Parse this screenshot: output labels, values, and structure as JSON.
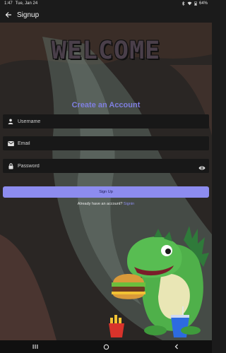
{
  "status_bar": {
    "time": "1:47",
    "date": "Tue, Jan 24",
    "battery": "64%",
    "icons": [
      "bluetooth-icon",
      "wifi-icon",
      "battery-icon"
    ]
  },
  "app_bar": {
    "title": "Signup",
    "back_icon": "arrow-back-icon"
  },
  "welcome_banner": "WELCOME",
  "heading": "Create an Account",
  "form": {
    "username": {
      "value": "",
      "placeholder": "Username",
      "icon": "person-icon"
    },
    "email": {
      "value": "",
      "placeholder": "Email",
      "icon": "mail-icon"
    },
    "password": {
      "value": "",
      "placeholder": "Password",
      "icon": "lock-icon",
      "toggle_icon": "eye-icon"
    },
    "submit_label": "Sign Up"
  },
  "login_prompt": {
    "text": "Already have an account?",
    "link": "Signin"
  },
  "colors": {
    "accent": "#8d8cef",
    "background": "#1b1b1b",
    "field_bg": "#181818"
  },
  "nav_bar": {
    "icons": [
      "recents-icon",
      "home-icon",
      "back-icon"
    ]
  }
}
